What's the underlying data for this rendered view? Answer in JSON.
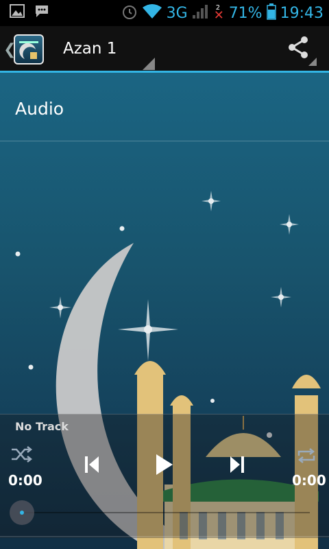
{
  "status_bar": {
    "network": "3G",
    "battery": "71%",
    "time": "19:43",
    "notification_count": "2"
  },
  "action_bar": {
    "title": "Azan 1",
    "icons": [
      "up-chevron-icon",
      "app-icon",
      "share-icon"
    ]
  },
  "main": {
    "section_label": "Audio"
  },
  "player": {
    "track": "No Track",
    "elapsed": "0:00",
    "duration": "0:00",
    "progress": 0,
    "icons": [
      "shuffle-icon",
      "previous-icon",
      "play-icon",
      "next-icon",
      "repeat-icon"
    ]
  },
  "colors": {
    "accent": "#33b5e5",
    "background": "#1b6583"
  }
}
